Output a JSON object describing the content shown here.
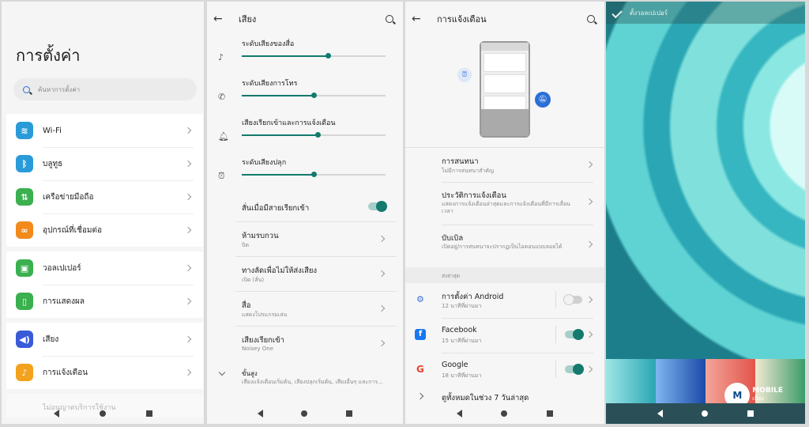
{
  "settings": {
    "title": "การตั้งค่า",
    "search_placeholder": "ค้นหาการตั้งค่า",
    "items": [
      {
        "label": "Wi-Fi",
        "icon": "wifi-icon",
        "color": "#2a9bd8"
      },
      {
        "label": "บลูทูธ",
        "icon": "bluetooth-icon",
        "color": "#2a9bd8"
      },
      {
        "label": "เครือข่ายมือถือ",
        "icon": "mobile-network-icon",
        "color": "#3ab04f"
      },
      {
        "label": "อุปกรณ์ที่เชื่อมต่อ",
        "icon": "link-icon",
        "color": "#f28a1c"
      },
      {
        "label": "วอลเปเปอร์",
        "icon": "wallpaper-icon",
        "color": "#3ab04f"
      },
      {
        "label": "การแสดงผล",
        "icon": "display-icon",
        "color": "#3ab04f"
      },
      {
        "label": "เสียง",
        "icon": "sound-icon",
        "color": "#3a5bd8"
      },
      {
        "label": "การแจ้งเตือน",
        "icon": "notification-icon",
        "color": "#f2a21c"
      }
    ],
    "partial_item": "ไม่อนุญาตบริการใช้งาน"
  },
  "sound": {
    "title": "เสียง",
    "sliders": [
      {
        "label": "ระดับเสียงของสื่อ",
        "icon": "music-note-icon",
        "level": 0.6
      },
      {
        "label": "ระดับเสียงการโทร",
        "icon": "phone-icon",
        "level": 0.5
      },
      {
        "label": "เสียงเรียกเข้าและการแจ้งเตือน",
        "icon": "bell-icon",
        "level": 0.53
      },
      {
        "label": "ระดับเสียงปลุก",
        "icon": "alarm-icon",
        "level": 0.5
      }
    ],
    "vibrate_label": "สั่นเมื่อมีสายเรียกเข้า",
    "vibrate_on": true,
    "rows": [
      {
        "title": "ห้ามรบกวน",
        "subtitle": "ปิด"
      },
      {
        "title": "ทางลัดเพื่อไม่ให้ส่งเสียง",
        "subtitle": "เปิด (สั่น)"
      },
      {
        "title": "สื่อ",
        "subtitle": "แสดงโปรแกรมเล่น"
      },
      {
        "title": "เสียงเรียกเข้า",
        "subtitle": "Noisey One"
      }
    ],
    "advanced_title": "ขั้นสูง",
    "advanced_subtitle": "เสียงแจ้งเตือนเริ่มต้น, เสียงปลุกเริ่มต้น, เสียงอื่นๆ และการ..."
  },
  "notifications": {
    "title": "การแจ้งเตือน",
    "rows": [
      {
        "title": "การสนทนา",
        "subtitle": "ไม่มีการสนทนาสำคัญ"
      },
      {
        "title": "ประวัติการแจ้งเตือน",
        "subtitle": "แสดงการแจ้งเตือนล่าสุดและการแจ้งเตือนที่มีการเลื่อนเวลา"
      },
      {
        "title": "บับเบิล",
        "subtitle": "เปิดอยู่/การสนทนาจะปรากฏเป็นไอคอนแบบลอยได้"
      }
    ],
    "section_label": "ส่งล่าสุด",
    "apps": [
      {
        "name": "การตั้งค่า Android",
        "time": "12 นาทีที่ผ่านมา",
        "icon": "gear-icon",
        "on": false
      },
      {
        "name": "Facebook",
        "time": "15 นาทีที่ผ่านมา",
        "icon": "facebook-icon",
        "on": true
      },
      {
        "name": "Google",
        "time": "18 นาทีที่ผ่านมา",
        "icon": "google-icon",
        "on": true
      }
    ],
    "see_all": "ดูทั้งหมดในช่วง 7 วันล่าสุด"
  },
  "wallpaper": {
    "title": "ตั้งวอลเปเปอร์",
    "logo_text": "MOBILE",
    "logo_sub": "เมือง"
  },
  "colors": {
    "accent": "#137a6d"
  }
}
